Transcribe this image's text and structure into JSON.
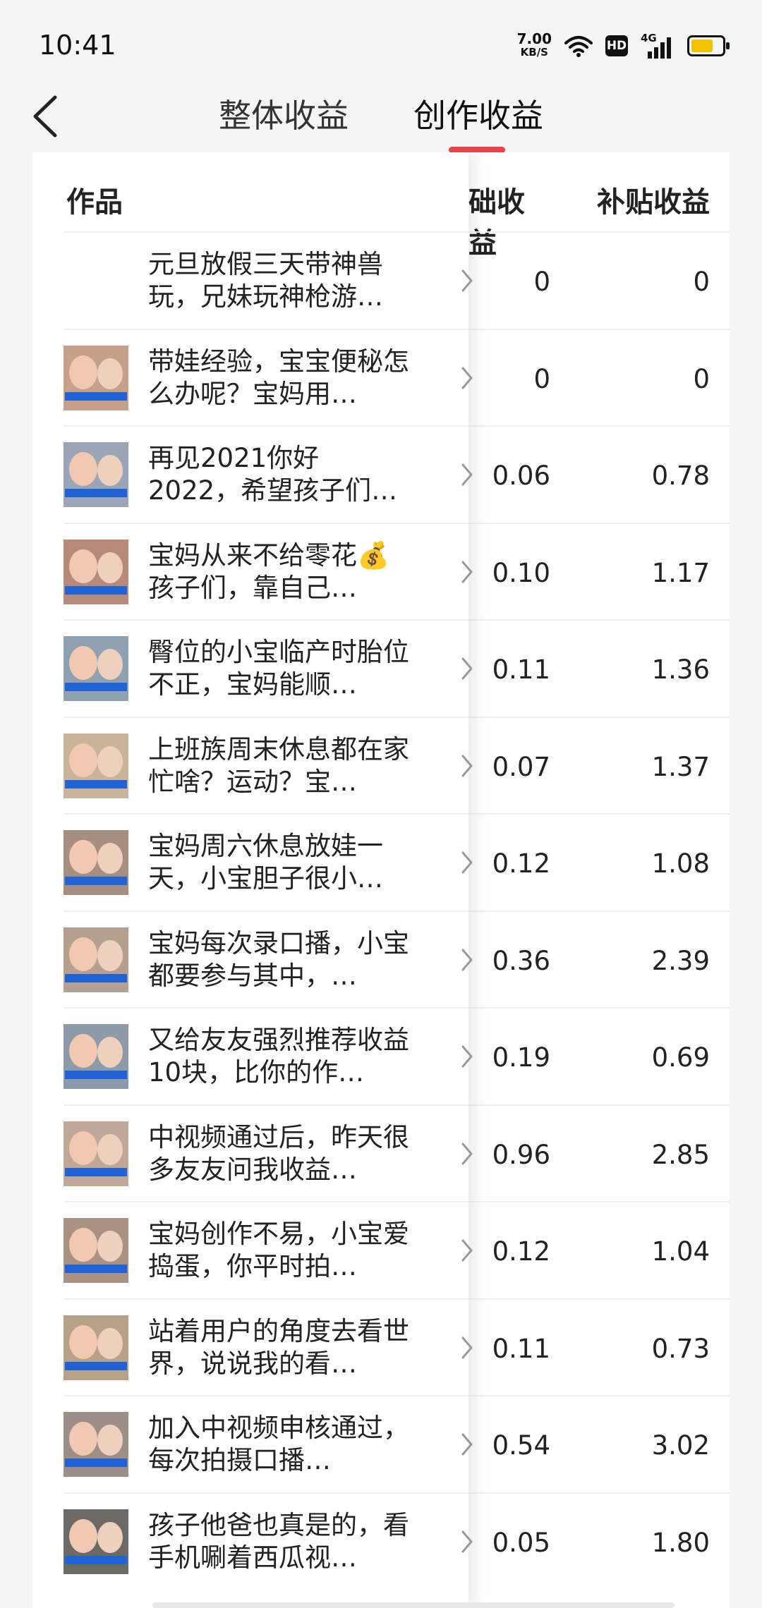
{
  "status": {
    "time": "10:41",
    "speed_value": "7.00",
    "speed_unit": "KB/S",
    "hd": "HD",
    "network": "4G"
  },
  "header": {
    "tabs": [
      {
        "label": "整体收益"
      },
      {
        "label": "创作收益"
      }
    ],
    "active_tab": 1,
    "accent_color": "#e8444a"
  },
  "table": {
    "headers": {
      "works": "作品",
      "base": "础收益",
      "subsidy": "补贴收益"
    },
    "rows": [
      {
        "title": "元旦放假三天带神兽玩，兄妹玩神枪游…",
        "base": "0",
        "subsidy": "0",
        "has_thumb": false
      },
      {
        "title": "带娃经验，宝宝便秘怎么办呢？宝妈用…",
        "base": "0",
        "subsidy": "0",
        "has_thumb": true
      },
      {
        "title": "再见2021你好2022，希望孩子们…",
        "base": "0.06",
        "subsidy": "0.78",
        "has_thumb": true
      },
      {
        "title": "宝妈从来不给零花💰孩子们，靠自己…",
        "base": "0.10",
        "subsidy": "1.17",
        "has_thumb": true
      },
      {
        "title": "臀位的小宝临产时胎位不正，宝妈能顺…",
        "base": "0.11",
        "subsidy": "1.36",
        "has_thumb": true
      },
      {
        "title": "上班族周末休息都在家忙啥？运动？宝…",
        "base": "0.07",
        "subsidy": "1.37",
        "has_thumb": true
      },
      {
        "title": "宝妈周六休息放娃一天，小宝胆子很小…",
        "base": "0.12",
        "subsidy": "1.08",
        "has_thumb": true
      },
      {
        "title": "宝妈每次录口播，小宝都要参与其中，…",
        "base": "0.36",
        "subsidy": "2.39",
        "has_thumb": true
      },
      {
        "title": "又给友友强烈推荐收益10块，比你的作…",
        "base": "0.19",
        "subsidy": "0.69",
        "has_thumb": true
      },
      {
        "title": "中视频通过后，昨天很多友友问我收益…",
        "base": "0.96",
        "subsidy": "2.85",
        "has_thumb": true
      },
      {
        "title": "宝妈创作不易，小宝爱捣蛋，你平时拍…",
        "base": "0.12",
        "subsidy": "1.04",
        "has_thumb": true
      },
      {
        "title": "站着用户的角度去看世界，说说我的看…",
        "base": "0.11",
        "subsidy": "0.73",
        "has_thumb": true
      },
      {
        "title": "加入中视频申核通过，每次拍摄口播…",
        "base": "0.54",
        "subsidy": "3.02",
        "has_thumb": true
      },
      {
        "title": "孩子他爸也真是的，看手机唰着西瓜视…",
        "base": "0.05",
        "subsidy": "1.80",
        "has_thumb": true
      }
    ]
  }
}
